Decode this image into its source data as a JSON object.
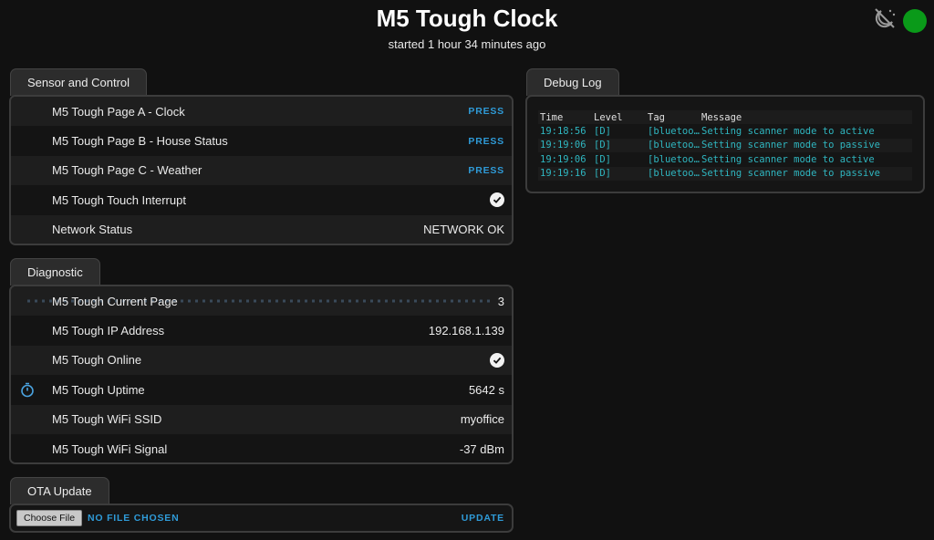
{
  "header": {
    "title": "M5 Tough Clock",
    "subtitle": "started 1 hour 34 minutes ago"
  },
  "status": {
    "connected_color": "#0a9a19"
  },
  "sensor_control": {
    "tab": "Sensor and Control",
    "rows": [
      {
        "label": "M5 Tough Page A - Clock",
        "action": "PRESS"
      },
      {
        "label": "M5 Tough Page B - House Status",
        "action": "PRESS"
      },
      {
        "label": "M5 Tough Page C - Weather",
        "action": "PRESS"
      },
      {
        "label": "M5 Tough Touch Interrupt",
        "icon": "check-circle-icon"
      },
      {
        "label": "Network Status",
        "value": "NETWORK OK"
      }
    ]
  },
  "diagnostic": {
    "tab": "Diagnostic",
    "rows": [
      {
        "label": "M5 Tough Current Page",
        "value": "3"
      },
      {
        "label": "M5 Tough IP Address",
        "value": "192.168.1.139"
      },
      {
        "label": "M5 Tough Online",
        "icon": "check-circle-icon"
      },
      {
        "label": "M5 Tough Uptime",
        "value": "5642 s",
        "lead_icon": "stopwatch-icon"
      },
      {
        "label": "M5 Tough WiFi SSID",
        "value": "myoffice"
      },
      {
        "label": "M5 Tough WiFi Signal",
        "value": "-37 dBm"
      }
    ]
  },
  "ota": {
    "tab": "OTA Update",
    "file_button": "Choose File",
    "file_name": "NO FILE CHOSEN",
    "update": "UPDATE"
  },
  "debug_log": {
    "tab": "Debug Log",
    "columns": [
      "Time",
      "Level",
      "Tag",
      "Message"
    ],
    "rows": [
      [
        "19:18:56",
        "[D]",
        "[bluetoo…",
        "Setting scanner mode to active"
      ],
      [
        "19:19:06",
        "[D]",
        "[bluetoo…",
        "Setting scanner mode to passive"
      ],
      [
        "19:19:06",
        "[D]",
        "[bluetoo…",
        "Setting scanner mode to active"
      ],
      [
        "19:19:16",
        "[D]",
        "[bluetoo…",
        "Setting scanner mode to passive"
      ]
    ]
  }
}
